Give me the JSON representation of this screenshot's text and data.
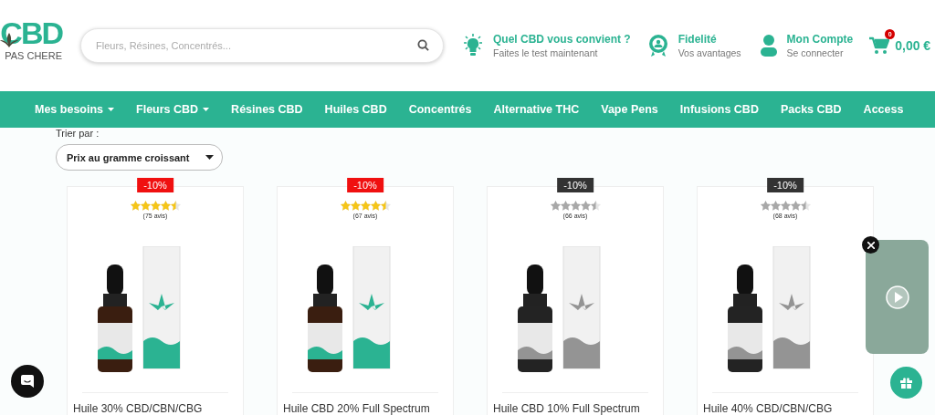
{
  "logo": {
    "main": "CBD",
    "sub": "PAS CHERE"
  },
  "search": {
    "placeholder": "Fleurs, Résines, Concentrés..."
  },
  "header_links": [
    {
      "kind": "bulb",
      "title": "Quel CBD vous convient ?",
      "subtitle": "Faites le test maintenant"
    },
    {
      "kind": "badge",
      "title": "Fidelité",
      "subtitle": "Vos avantages"
    },
    {
      "kind": "user",
      "title": "Mon Compte",
      "subtitle": "Se connecter"
    }
  ],
  "cart": {
    "count": "0",
    "total": "0,00 €"
  },
  "nav": [
    {
      "label": "Mes besoins",
      "has_menu": true
    },
    {
      "label": "Fleurs CBD",
      "has_menu": true
    },
    {
      "label": "Résines CBD",
      "has_menu": false
    },
    {
      "label": "Huiles CBD",
      "has_menu": false
    },
    {
      "label": "Concentrés",
      "has_menu": false
    },
    {
      "label": "Alternative THC",
      "has_menu": false
    },
    {
      "label": "Vape Pens",
      "has_menu": false
    },
    {
      "label": "Infusions CBD",
      "has_menu": false
    },
    {
      "label": "Packs CBD",
      "has_menu": false
    },
    {
      "label": "Access",
      "has_menu": false
    }
  ],
  "sort": {
    "label": "Trier par :",
    "value": "Prix au gramme croissant"
  },
  "products": [
    {
      "discount": "-10%",
      "available": true,
      "stars": 4.5,
      "reviews": "(75 avis)",
      "name": "Huile 30% CBD/CBN/CBG"
    },
    {
      "discount": "-10%",
      "available": true,
      "stars": 4.5,
      "reviews": "(67 avis)",
      "name": "Huile CBD 20% Full Spectrum"
    },
    {
      "discount": "-10%",
      "available": false,
      "stars": 4.5,
      "reviews": "(66 avis)",
      "name": "Huile CBD 10% Full Spectrum"
    },
    {
      "discount": "-10%",
      "available": false,
      "stars": 4.5,
      "reviews": "(68 avis)",
      "name": "Huile 40% CBD/CBN/CBG"
    }
  ]
}
